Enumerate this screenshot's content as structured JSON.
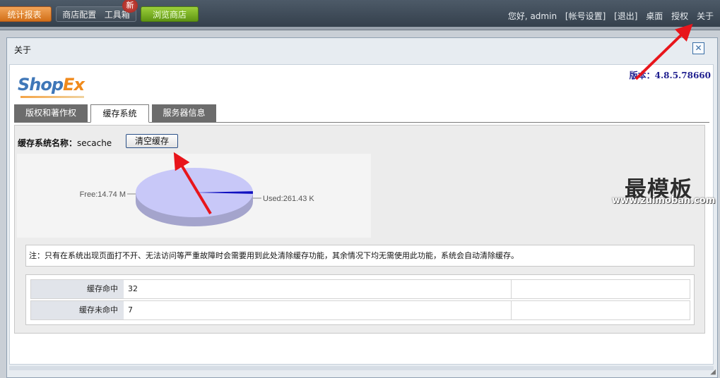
{
  "topnav": {
    "stats_label": "统计报表",
    "shop_config_label": "商店配置",
    "toolbox_label": "工具箱",
    "new_badge": "新",
    "browse_label": "浏览商店"
  },
  "userbar": {
    "greeting": "您好, admin",
    "account_settings": "[帐号设置]",
    "logout": "[退出]",
    "desktop": "桌面",
    "license": "授权",
    "about": "关于"
  },
  "dialog": {
    "title": "关于",
    "close_symbol": "✕",
    "logo_part1": "Shop",
    "logo_part2": "Ex",
    "version": "版本：4.8.5.78660"
  },
  "tabs": [
    "版权和著作权",
    "缓存系统",
    "服务器信息"
  ],
  "active_tab_index": 1,
  "cache": {
    "name_label": "缓存系统名称：",
    "name_value": "secache",
    "clear_button": "清空缓存",
    "note": "注：只有在系统出现页面打不开、无法访问等严重故障时会需要用到此处清除缓存功能，其余情况下均无需使用此功能，系统会自动清除缓存。",
    "stats": [
      {
        "label": "缓存命中",
        "value": "32"
      },
      {
        "label": "缓存未命中",
        "value": "7"
      }
    ]
  },
  "chart_data": {
    "type": "pie",
    "slices": [
      {
        "label": "Free:14.74 M",
        "value": 15093.76,
        "color": "#c8c8f8"
      },
      {
        "label": "Used:261.43 K",
        "value": 261.43,
        "color": "#1010c0"
      }
    ]
  },
  "watermark": {
    "line1": "最模板",
    "line2": "www.zuimoban.com"
  },
  "colors": {
    "accent_blue": "#2a4f86",
    "arrow_red": "#e8151b",
    "orange_button": "#d26f18",
    "green_button": "#5f9512"
  }
}
